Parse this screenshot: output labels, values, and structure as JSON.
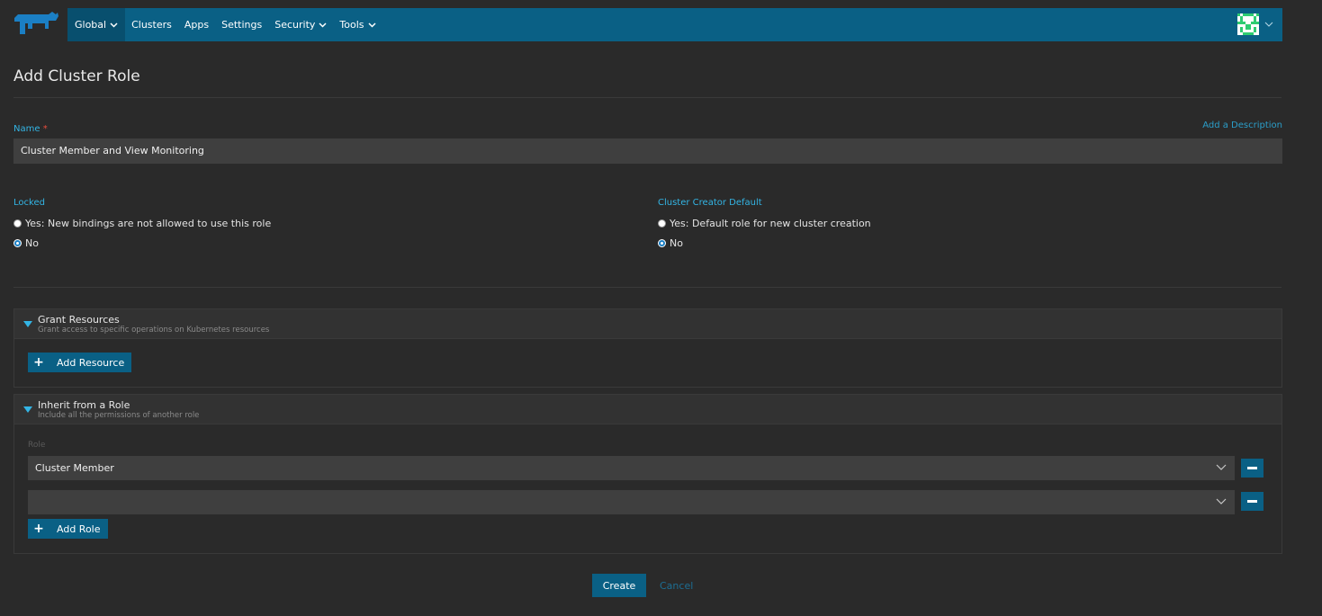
{
  "nav": {
    "items": [
      {
        "label": "Global",
        "dropdown": true
      },
      {
        "label": "Clusters",
        "dropdown": false
      },
      {
        "label": "Apps",
        "dropdown": false
      },
      {
        "label": "Settings",
        "dropdown": false
      },
      {
        "label": "Security",
        "dropdown": true
      },
      {
        "label": "Tools",
        "dropdown": true
      }
    ],
    "active_item": "Global",
    "logo_icon": "rancher-logo-icon",
    "avatar_icon": "user-avatar-icon"
  },
  "page": {
    "title": "Add Cluster Role"
  },
  "form": {
    "name_label": "Name",
    "required_mark": "*",
    "add_description_link": "Add a Description",
    "name_value": "Cluster Member and View Monitoring",
    "locked": {
      "label": "Locked",
      "options": [
        {
          "label": "Yes: New bindings are not allowed to use this role",
          "checked": false
        },
        {
          "label": "No",
          "checked": true
        }
      ]
    },
    "cluster_creator_default": {
      "label": "Cluster Creator Default",
      "options": [
        {
          "label": "Yes: Default role for new cluster creation",
          "checked": false
        },
        {
          "label": "No",
          "checked": true
        }
      ]
    }
  },
  "grant_resources": {
    "title": "Grant Resources",
    "subtitle": "Grant access to specific operations on Kubernetes resources",
    "add_button": "Add Resource"
  },
  "inherit_role": {
    "title": "Inherit from a Role",
    "subtitle": "Include all the permissions of another role",
    "role_label": "Role",
    "roles": [
      "Cluster Member",
      ""
    ],
    "add_button": "Add Role"
  },
  "footer": {
    "create_label": "Create",
    "cancel_label": "Cancel"
  },
  "colors": {
    "background": "#2a2a2a",
    "navbar": "#0a6085",
    "accent": "#33b5e5",
    "input": "#3f3f3f"
  }
}
